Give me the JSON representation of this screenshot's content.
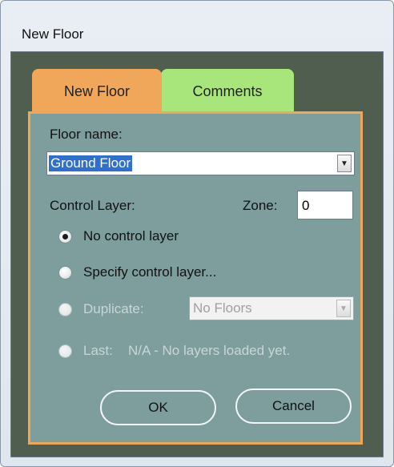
{
  "window": {
    "title": "New Floor"
  },
  "tabs": [
    {
      "label": "New Floor",
      "active": true
    },
    {
      "label": "Comments",
      "active": false
    }
  ],
  "form": {
    "floor_name_label": "Floor name:",
    "floor_name_value": "Ground Floor",
    "control_layer_label": "Control Layer:",
    "zone_label": "Zone:",
    "zone_value": "0",
    "options": [
      {
        "label": "No control layer",
        "checked": true,
        "enabled": true
      },
      {
        "label": "Specify control layer...",
        "checked": false,
        "enabled": true
      },
      {
        "label": "Duplicate:",
        "checked": false,
        "enabled": false
      },
      {
        "label": "Last:",
        "checked": false,
        "enabled": false
      }
    ],
    "duplicate_value": "No Floors",
    "last_info": "N/A - No layers loaded yet."
  },
  "buttons": {
    "ok": "OK",
    "cancel": "Cancel"
  },
  "colors": {
    "dialog_background": "#4f5e4f",
    "panel_background": "#7e9e9e",
    "active_tab": "#f0a75a",
    "inactive_tab": "#a8e67c",
    "selection": "#2f6fce"
  }
}
